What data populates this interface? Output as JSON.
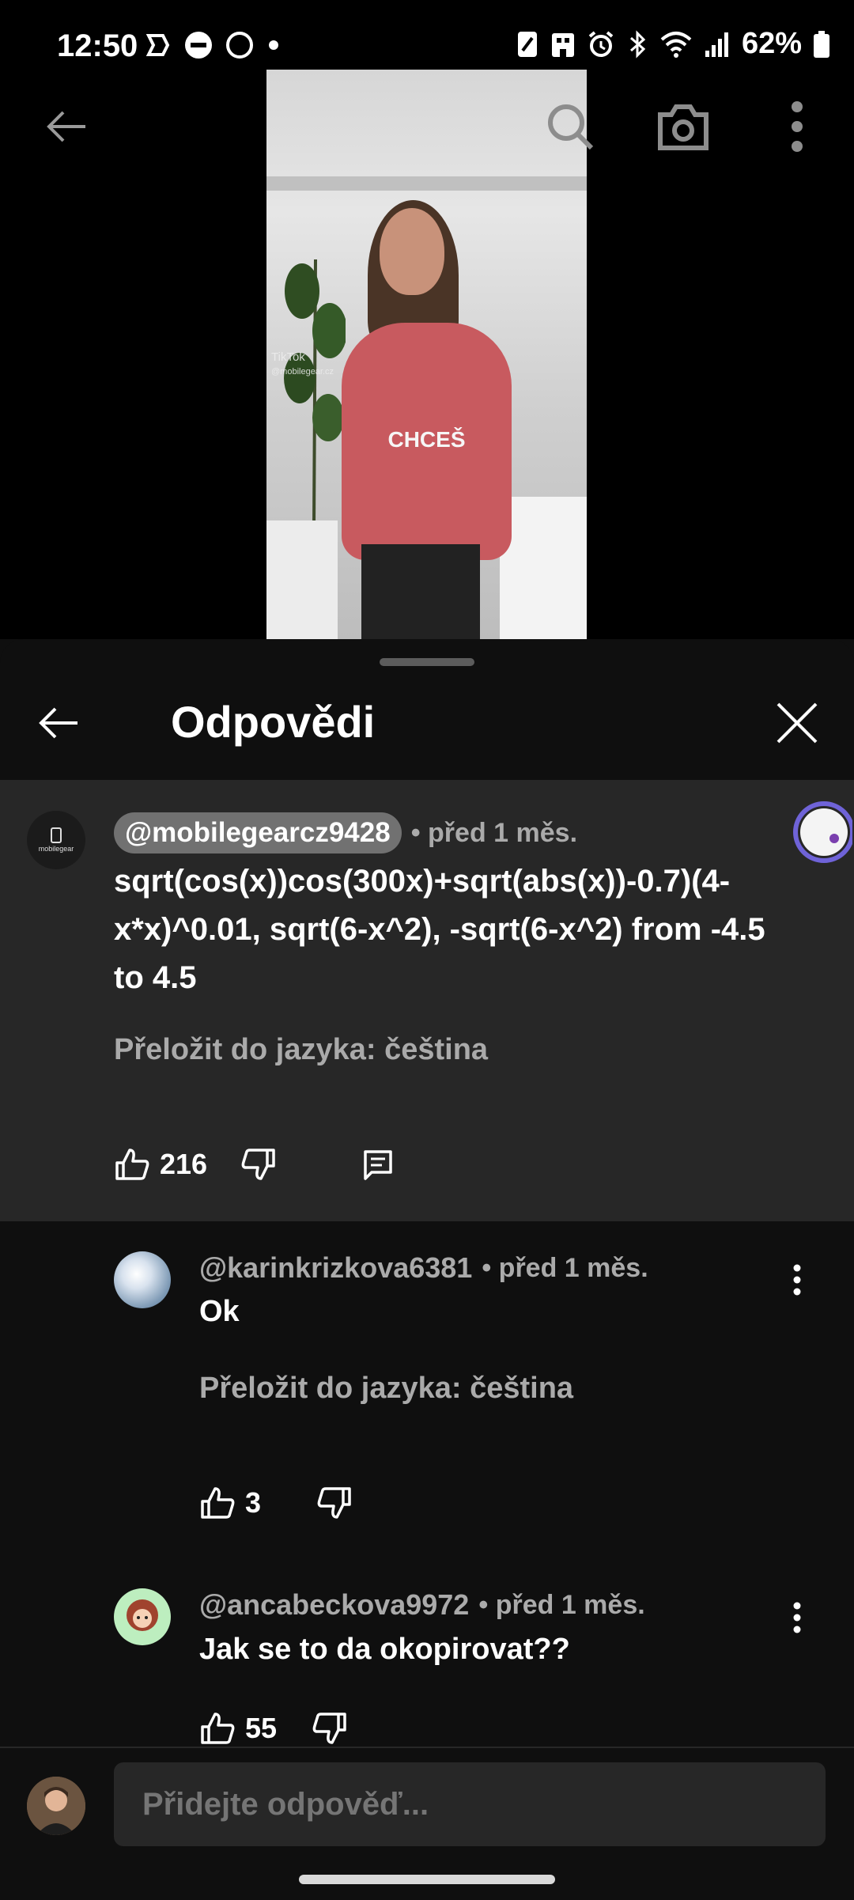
{
  "status_bar": {
    "time": "12:50",
    "battery": "62%",
    "icons_left": [
      "tasker-icon",
      "dnd-icon",
      "circle-icon",
      "dot-icon"
    ],
    "icons_right": [
      "nfc-icon",
      "work-icon",
      "alarm-icon",
      "bluetooth-icon",
      "wifi-icon",
      "signal-icon",
      "battery-icon"
    ]
  },
  "video": {
    "watermark": "TikTok",
    "watermark_handle": "@mobilegear.cz",
    "caption": "CHCEŠ"
  },
  "sheet": {
    "title": "Odpovědi"
  },
  "main_comment": {
    "author": "@mobilegearcz9428",
    "time": "• před 1 měs.",
    "text": "sqrt(cos(x))cos(300x)+sqrt(abs(x))-0.7)(4-x*x)^0.01, sqrt(6-x^2), -sqrt(6-x^2) from -4.5 to 4.5",
    "translate": "Přeložit do jazyka: čeština",
    "likes": "216",
    "avatar_text": "mobilegear"
  },
  "replies": [
    {
      "author": "@karinkrizkova6381",
      "time": "• před 1 měs.",
      "text": "Ok",
      "translate": "Přeložit do jazyka: čeština",
      "likes": "3"
    },
    {
      "author": "@ancabeckova9972",
      "time": "• před 1 měs.",
      "text": "Jak se to da okopirovat??",
      "likes": "55"
    }
  ],
  "input": {
    "placeholder": "Přidejte odpověď..."
  },
  "colors": {
    "background": "#0f0f0f",
    "highlight": "#272727",
    "muted_text": "#aaaaaa"
  }
}
